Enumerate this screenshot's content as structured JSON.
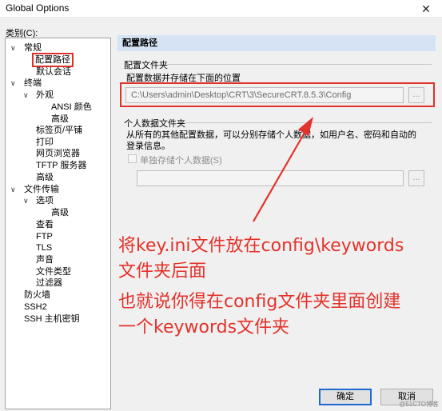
{
  "window": {
    "title": "Global Options",
    "close_glyph": "✕"
  },
  "category_label": "类别(C):",
  "tree": {
    "expanded_glyph": "∨",
    "items": [
      {
        "label": "常规",
        "expanded": true
      },
      {
        "label": "配置路径",
        "selected": true
      },
      {
        "label": "默认会话"
      },
      {
        "label": "终端",
        "expanded": true
      },
      {
        "label": "外观",
        "expanded": true
      },
      {
        "label": "ANSI 颜色"
      },
      {
        "label": "高级"
      },
      {
        "label": "标签页/平铺"
      },
      {
        "label": "打印"
      },
      {
        "label": "网页浏览器"
      },
      {
        "label": "TFTP 服务器"
      },
      {
        "label": "高级"
      },
      {
        "label": "文件传输",
        "expanded": true
      },
      {
        "label": "选项",
        "expanded": true
      },
      {
        "label": "高级"
      },
      {
        "label": "查看"
      },
      {
        "label": "FTP"
      },
      {
        "label": "TLS"
      },
      {
        "label": "声音"
      },
      {
        "label": "文件类型"
      },
      {
        "label": "过滤器"
      },
      {
        "label": "防火墙"
      },
      {
        "label": "SSH2"
      },
      {
        "label": "SSH 主机密钥"
      }
    ]
  },
  "panel": {
    "header": "配置路径",
    "config_folder": {
      "title": "配置文件夹",
      "description": "配置数据并存储在下面的位置",
      "path": "C:\\Users\\admin\\Desktop\\CRT\\3\\SecureCRT.8.5.3\\Config",
      "browse_label": "..."
    },
    "personal_folder": {
      "title": "个人数据文件夹",
      "description_line1": "从所有的其他配置数据，可以分别存储个人数据，如用户名、密码和自动的",
      "description_line2": "登录信息。",
      "checkbox_label": "单独存储个人数据(S)",
      "checkbox_checked": false,
      "path": "",
      "browse_label": "..."
    }
  },
  "buttons": {
    "ok": "确定",
    "cancel": "取消"
  },
  "annotation": {
    "color": "#e3322b",
    "lines": [
      "将key.ini文件放在config\\keywords",
      "文件夹后面",
      "也就说你得在config文件夹里面创建",
      "一个keywords文件夹"
    ]
  },
  "watermark": "@51CTO博客"
}
